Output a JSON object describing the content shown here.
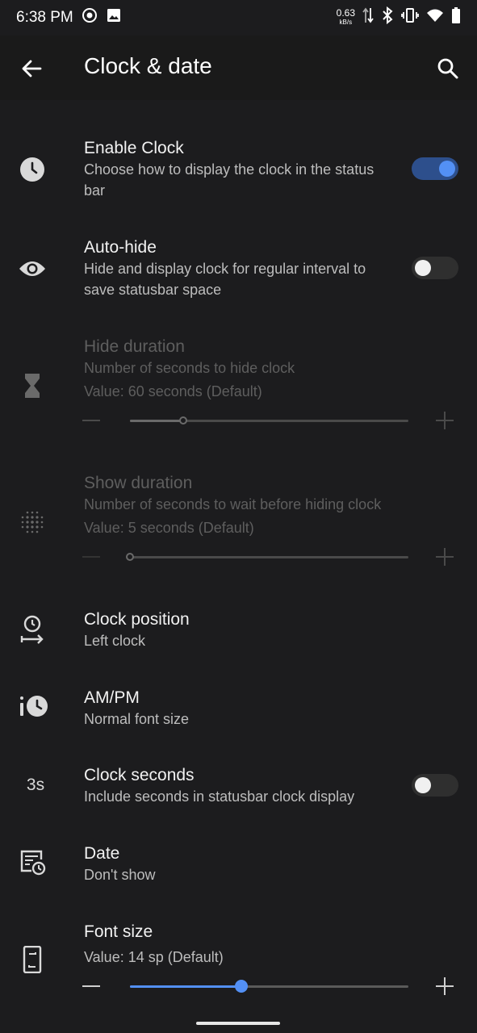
{
  "status_bar": {
    "time": "6:38 PM",
    "net_speed_value": "0.63",
    "net_speed_unit": "kB/s"
  },
  "app_bar": {
    "title": "Clock & date"
  },
  "prefs": {
    "enable_clock": {
      "title": "Enable Clock",
      "summary": "Choose how to display the clock in the status bar",
      "checked": true
    },
    "auto_hide": {
      "title": "Auto-hide",
      "summary": "Hide and display clock for regular interval to save statusbar space",
      "checked": false
    },
    "hide_duration": {
      "title": "Hide duration",
      "summary": "Number of seconds to hide clock",
      "value_text": "Value: 60 seconds (Default)",
      "slider_fraction": 0.19,
      "enabled": false
    },
    "show_duration": {
      "title": "Show duration",
      "summary": "Number of seconds to wait before hiding clock",
      "value_text": "Value: 5 seconds (Default)",
      "slider_fraction": 0.0,
      "enabled": false
    },
    "clock_position": {
      "title": "Clock position",
      "summary": "Left clock"
    },
    "ampm": {
      "title": "AM/PM",
      "summary": "Normal font size"
    },
    "clock_seconds": {
      "icon_text": "3s",
      "title": "Clock seconds",
      "summary": "Include seconds in statusbar clock display",
      "checked": false
    },
    "date": {
      "title": "Date",
      "summary": "Don't show"
    },
    "font_size": {
      "title": "Font size",
      "value_text": "Value: 14 sp (Default)",
      "slider_fraction": 0.4
    }
  },
  "colors": {
    "accent": "#5390f5",
    "background": "#1c1c1e"
  },
  "icons": {
    "status": [
      "screen-record-icon",
      "image-icon",
      "data-arrows-icon",
      "bluetooth-icon",
      "vibrate-icon",
      "wifi-icon",
      "battery-icon"
    ],
    "app_bar": [
      "back-arrow-icon",
      "search-icon"
    ],
    "prefs": [
      "clock-icon",
      "eye-icon",
      "hourglass-icon",
      "dots-grid-icon",
      "clock-position-icon",
      "ampm-clock-icon",
      "date-icon",
      "phone-font-icon"
    ]
  }
}
